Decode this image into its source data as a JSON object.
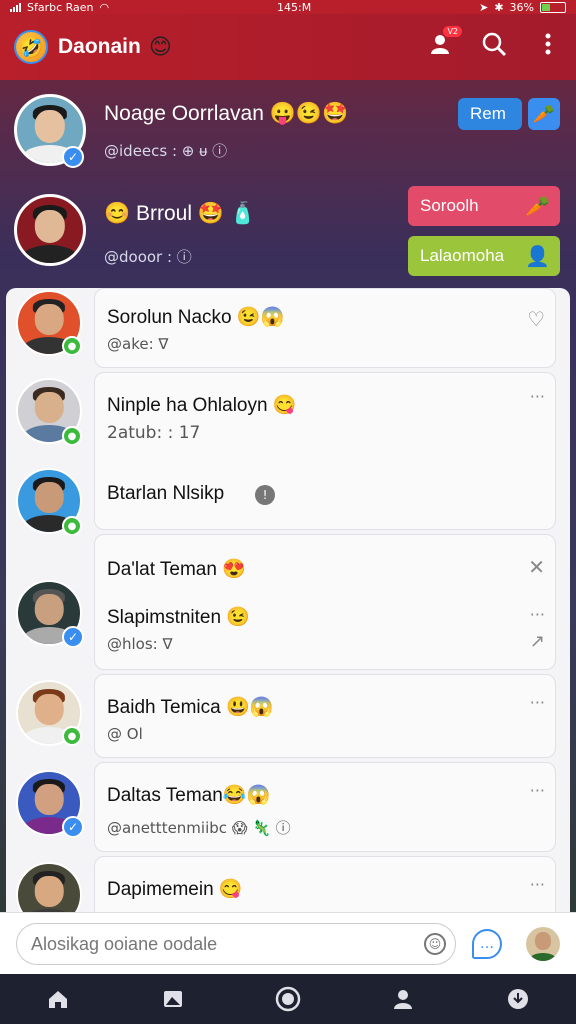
{
  "status_bar": {
    "carrier": "Sfarbc Raen",
    "time": "145:M",
    "battery": "36%"
  },
  "header": {
    "title": "Daonain",
    "title_emoji": "😊",
    "logo_emoji": "🤣",
    "notification_badge": "V2"
  },
  "featured": [
    {
      "name": "Noage Oorrlavan 😛😉🤩",
      "sub": "@ideecs : ⊕ ᵾ ⓘ",
      "button_label": "Rem",
      "button_icon": "🥕"
    },
    {
      "name": "😊 Brroul 🤩 🧴",
      "sub": "@dooor : ⓘ",
      "button1_label": "Soroolh",
      "button1_icon": "🥕",
      "button2_label": "Lalaomoha",
      "button2_icon": "👤"
    }
  ],
  "contacts": [
    {
      "name": "Sorolun Nacko 😉😱",
      "sub": "@ake: ∇",
      "action": "♡"
    },
    {
      "name": "Ninple ha Ohlaloyn 😋",
      "sub": "2atub: : 17",
      "action": "···"
    },
    {
      "name": "Btarlan Nlsikp",
      "sub": "",
      "action": ""
    },
    {
      "name": "Da'lat Teman 😍",
      "sub": "",
      "action": "✕"
    },
    {
      "name": "Slapimstniten 😉",
      "sub": "@hlos: ∇",
      "action": "···"
    },
    {
      "name": "Baidh Temica 😃😱",
      "sub": "@ Ol",
      "action": "···"
    },
    {
      "name": "Daltas Teman😂😱",
      "sub": "@anetttenmiibc 😱 🦎 ⓘ",
      "action": "···"
    },
    {
      "name": "Dapimemein 😋",
      "sub": "",
      "action": "···"
    }
  ],
  "composer": {
    "placeholder": "Alosikag ooiane oodale"
  },
  "colors": {
    "header": "#b81f2a",
    "accent_blue": "#2f86e0",
    "accent_pink": "#e24c6a",
    "accent_green": "#9bc53a",
    "nav": "#1e2130"
  }
}
